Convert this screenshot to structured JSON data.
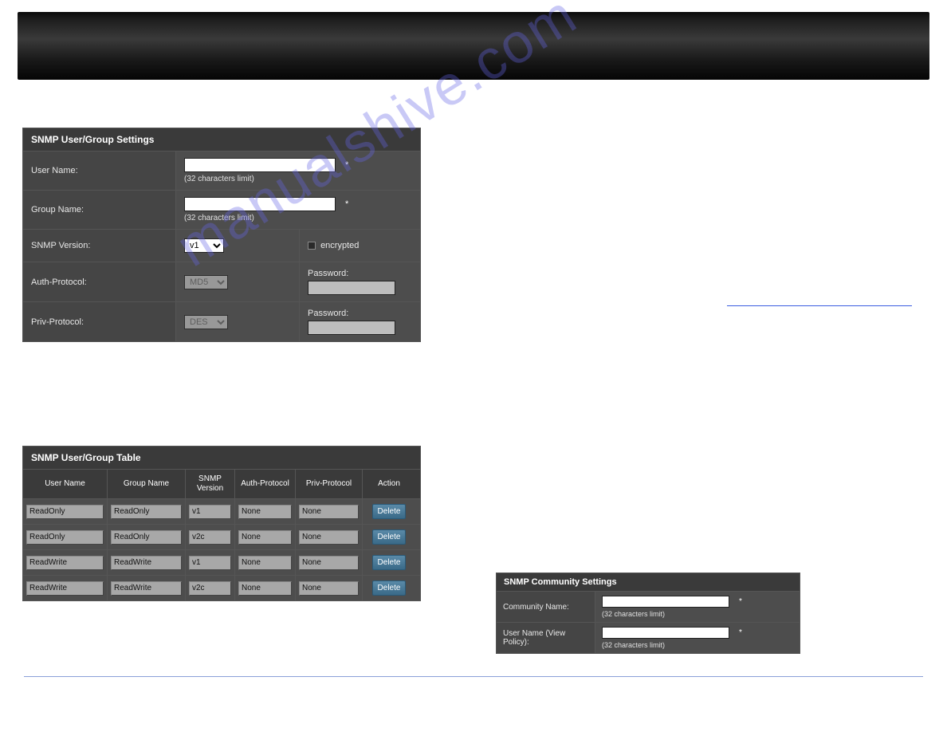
{
  "banner": {},
  "settings_panel": {
    "title": "SNMP User/Group Settings",
    "user_name_label": "User Name:",
    "user_name_value": "",
    "user_name_hint": "(32 characters limit)",
    "group_name_label": "Group Name:",
    "group_name_value": "",
    "group_name_hint": "(32 characters limit)",
    "snmp_version_label": "SNMP Version:",
    "snmp_version_value": "v1",
    "encrypted_label": "encrypted",
    "auth_protocol_label": "Auth-Protocol:",
    "auth_protocol_value": "MD5",
    "auth_password_label": "Password:",
    "auth_password_value": "",
    "priv_protocol_label": "Priv-Protocol:",
    "priv_protocol_value": "DES",
    "priv_password_label": "Password:",
    "priv_password_value": "",
    "asterisk": "*"
  },
  "table_panel": {
    "title": "SNMP User/Group Table",
    "headers": {
      "user": "User Name",
      "group": "Group Name",
      "version": "SNMP Version",
      "auth": "Auth-Protocol",
      "priv": "Priv-Protocol",
      "action": "Action"
    },
    "delete_label": "Delete",
    "rows": [
      {
        "user": "ReadOnly",
        "group": "ReadOnly",
        "version": "v1",
        "auth": "None",
        "priv": "None"
      },
      {
        "user": "ReadOnly",
        "group": "ReadOnly",
        "version": "v2c",
        "auth": "None",
        "priv": "None"
      },
      {
        "user": "ReadWrite",
        "group": "ReadWrite",
        "version": "v1",
        "auth": "None",
        "priv": "None"
      },
      {
        "user": "ReadWrite",
        "group": "ReadWrite",
        "version": "v2c",
        "auth": "None",
        "priv": "None"
      }
    ]
  },
  "community_panel": {
    "title": "SNMP Community Settings",
    "community_name_label": "Community Name:",
    "community_name_value": "",
    "community_name_hint": "(32 characters limit)",
    "user_name_label": "User Name (View Policy):",
    "user_name_value": "",
    "user_name_hint": "(32 characters limit)",
    "asterisk": "*"
  },
  "watermark_text": "manualshive.com"
}
